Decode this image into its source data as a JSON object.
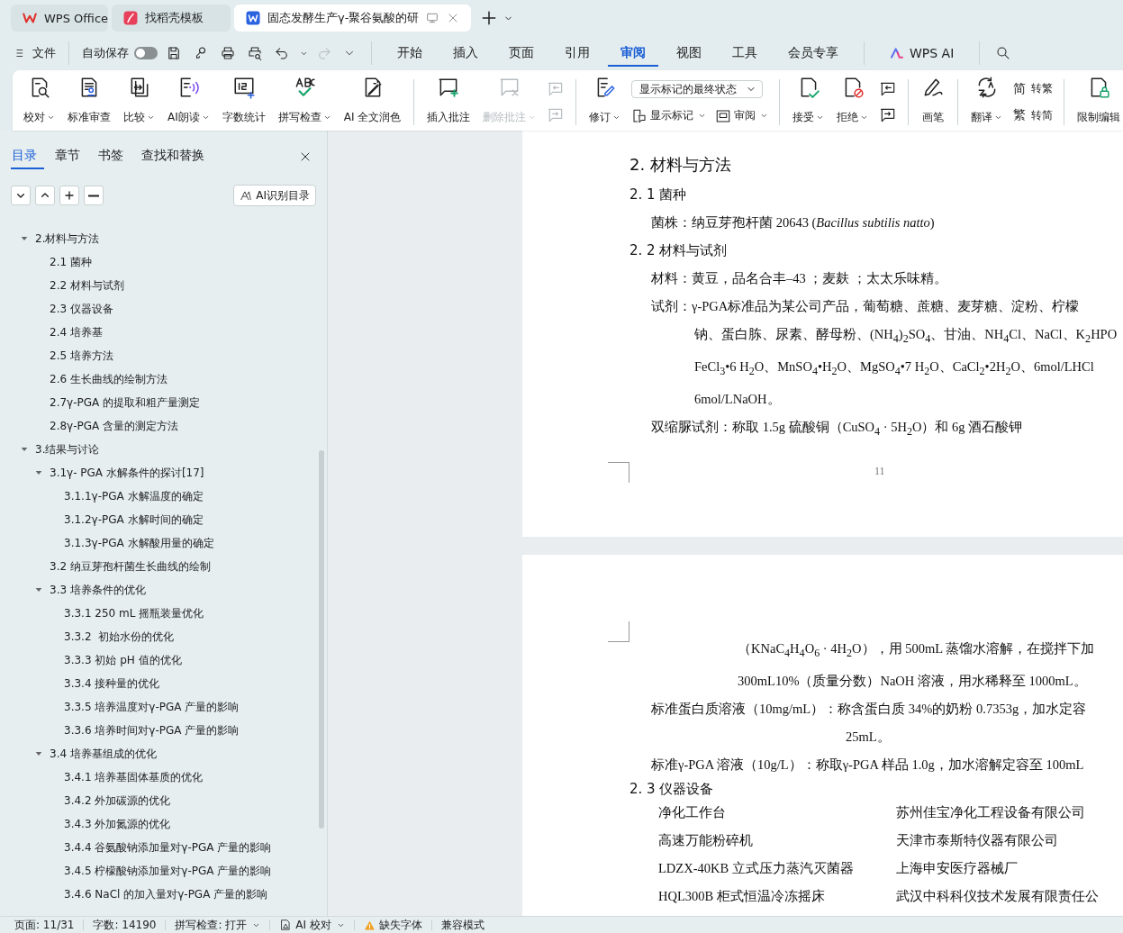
{
  "title_bar": {
    "tabs": [
      {
        "kind": "home",
        "label": "WPS Office",
        "selected": false
      },
      {
        "kind": "template",
        "label": "找稻壳模板",
        "selected": false
      },
      {
        "kind": "document",
        "label": "固态发酵生产γ-聚谷氨酸的研",
        "selected": true
      }
    ]
  },
  "menu_bar": {
    "file_menu": "文件",
    "autosave": {
      "label": "自动保存",
      "on": false
    },
    "redo_disabled": true,
    "tabs": [
      {
        "label": "开始",
        "selected": false
      },
      {
        "label": "插入",
        "selected": false
      },
      {
        "label": "页面",
        "selected": false
      },
      {
        "label": "引用",
        "selected": false
      },
      {
        "label": "审阅",
        "selected": true
      },
      {
        "label": "视图",
        "selected": false
      },
      {
        "label": "工具",
        "selected": false
      },
      {
        "label": "会员专享",
        "selected": false
      }
    ],
    "ai_label": "WPS AI"
  },
  "ribbon": {
    "groups": [
      {
        "items": [
          {
            "kind": "large",
            "label": "校对",
            "dropdown": true,
            "disabled": false
          },
          {
            "kind": "large",
            "label": "标准审查",
            "dropdown": false,
            "disabled": false
          },
          {
            "kind": "large",
            "label": "比较",
            "dropdown": true,
            "disabled": false
          },
          {
            "kind": "large",
            "label": "AI朗读",
            "dropdown": true,
            "disabled": false
          },
          {
            "kind": "large",
            "label": "字数统计",
            "dropdown": false,
            "disabled": false
          },
          {
            "kind": "large",
            "label": "拼写检查",
            "dropdown": true,
            "disabled": false
          },
          {
            "kind": "large",
            "label": "AI 全文润色",
            "dropdown": false,
            "disabled": false
          }
        ]
      },
      {
        "items": [
          {
            "kind": "large",
            "label": "插入批注",
            "dropdown": false,
            "disabled": false
          },
          {
            "kind": "large",
            "label": "删除批注",
            "dropdown": true,
            "disabled": true
          },
          {
            "kind": "stack",
            "rows": [
              [
                {
                  "kind": "icon",
                  "disabled": true
                }
              ],
              [
                {
                  "kind": "icon",
                  "disabled": true
                }
              ]
            ]
          }
        ]
      },
      {
        "items": [
          {
            "kind": "large",
            "label": "修订",
            "dropdown": true,
            "disabled": false
          },
          {
            "kind": "stack",
            "rows": [
              [
                {
                  "kind": "select",
                  "value": "显示标记的最终状态"
                }
              ],
              [
                {
                  "kind": "small",
                  "label": "显示标记",
                  "dropdown": true,
                  "disabled": false
                },
                {
                  "kind": "small",
                  "label": "审阅",
                  "dropdown": true,
                  "disabled": false
                }
              ]
            ]
          }
        ]
      },
      {
        "items": [
          {
            "kind": "large",
            "label": "接受",
            "dropdown": true,
            "disabled": false
          },
          {
            "kind": "large",
            "label": "拒绝",
            "dropdown": true,
            "disabled": false
          },
          {
            "kind": "stack",
            "rows": [
              [
                {
                  "kind": "icon",
                  "disabled": false
                }
              ],
              [
                {
                  "kind": "icon",
                  "disabled": false
                }
              ]
            ]
          }
        ]
      },
      {
        "items": [
          {
            "kind": "large",
            "label": "画笔",
            "dropdown": false,
            "disabled": false
          }
        ]
      },
      {
        "items": [
          {
            "kind": "large",
            "label": "翻译",
            "dropdown": true,
            "disabled": false
          },
          {
            "kind": "stack",
            "rows": [
              [
                {
                  "kind": "convert",
                  "glyph": "简",
                  "label": "转繁"
                }
              ],
              [
                {
                  "kind": "convert",
                  "glyph": "繁",
                  "label": "转简"
                }
              ]
            ]
          }
        ]
      },
      {
        "items": [
          {
            "kind": "large",
            "label": "限制编辑",
            "dropdown": false,
            "disabled": false
          }
        ]
      }
    ]
  },
  "side_panel": {
    "tabs": [
      {
        "label": "目录",
        "selected": true
      },
      {
        "label": "章节",
        "selected": false
      },
      {
        "label": "书签",
        "selected": false
      },
      {
        "label": "查找和替换",
        "selected": false
      }
    ],
    "ai_button": "AI识别目录",
    "toc": [
      {
        "label": "2.材料与方法",
        "expanded": true,
        "children": [
          {
            "label": "2.1 菌种"
          },
          {
            "label": "2.2 材料与试剂"
          },
          {
            "label": "2.3 仪器设备"
          },
          {
            "label": "2.4 培养基"
          },
          {
            "label": "2.5 培养方法"
          },
          {
            "label": "2.6 生长曲线的绘制方法"
          },
          {
            "label": "2.7γ-PGA 的提取和粗产量测定"
          },
          {
            "label": "2.8γ-PGA 含量的测定方法"
          }
        ]
      },
      {
        "label": "3.结果与讨论",
        "expanded": true,
        "children": [
          {
            "label": "3.1γ- PGA 水解条件的探讨[17]",
            "expanded": true,
            "children": [
              {
                "label": "3.1.1γ-PGA 水解温度的确定"
              },
              {
                "label": "3.1.2γ-PGA 水解时间的确定"
              },
              {
                "label": "3.1.3γ-PGA 水解酸用量的确定"
              }
            ]
          },
          {
            "label": "3.2 纳豆芽孢杆菌生长曲线的绘制"
          },
          {
            "label": "3.3 培养条件的优化",
            "expanded": true,
            "children": [
              {
                "label": "3.3.1 250 mL 摇瓶装量优化"
              },
              {
                "label": "3.3.2  初始水份的优化"
              },
              {
                "label": "3.3.3 初始 pH 值的优化"
              },
              {
                "label": "3.3.4 接种量的优化"
              },
              {
                "label": "3.3.5 培养温度对γ-PGA 产量的影响"
              },
              {
                "label": "3.3.6 培养时间对γ-PGA 产量的影响"
              }
            ]
          },
          {
            "label": "3.4 培养基组成的优化",
            "expanded": true,
            "children": [
              {
                "label": "3.4.1 培养基固体基质的优化"
              },
              {
                "label": "3.4.2 外加碳源的优化"
              },
              {
                "label": "3.4.3 外加氮源的优化"
              },
              {
                "label": "3.4.4 谷氨酸钠添加量对γ-PGA 产量的影响"
              },
              {
                "label": "3.4.5 柠檬酸钠添加量对γ-PGA 产量的影响"
              },
              {
                "label": "3.4.6 NaCl 的加入量对γ-PGA 产量的影响"
              }
            ]
          }
        ]
      }
    ]
  },
  "document": {
    "pages": [
      {
        "lines": [
          {
            "kind": "heading",
            "text": "2. 材料与方法"
          },
          {
            "kind": "subheading",
            "text": "2. 1 菌种"
          },
          {
            "kind": "l1",
            "text": "菌株：纳豆芽孢杆菌 20643 (*Bacillus subtilis natto*)"
          },
          {
            "kind": "subheading",
            "text": "2. 2 材料与试剂"
          },
          {
            "kind": "l1",
            "text": "材料：黄豆，品名合丰–43 ；麦麸 ；太太乐味精。"
          },
          {
            "kind": "l1",
            "text": "试剂：γ-PGA标准品为某公司产品，葡萄糖、蔗糖、麦芽糖、淀粉、柠檬"
          },
          {
            "kind": "l2",
            "text": "钠、蛋白胨、尿素、酵母粉、(NH$_{4}$)$_{2}$SO$_{4}$、甘油、NH$_{4}$Cl、NaCl、K$_{2}$HPO"
          },
          {
            "kind": "l2",
            "text": "FeCl$_{3}$•6 H$_{2}$O、MnSO$_{4}$•H$_{2}$O、MgSO$_{4}$•7 H$_{2}$O、CaCl$_{2}$•2H$_{2}$O、6mol/LHCl"
          },
          {
            "kind": "l2",
            "text": "6mol/LNaOH。"
          },
          {
            "kind": "l1",
            "text": "双缩脲试剂：称取 1.5g 硫酸铜（CuSO$_{4}$ · 5H$_{2}$O）和 6g 酒石酸钾"
          }
        ],
        "page_number": "11"
      },
      {
        "lines": [
          {
            "kind": "l3",
            "text": "（KNaC$_{4}$H$_{4}$O$_{6}$ · 4H$_{2}$O），用 500mL 蒸馏水溶解，在搅拌下加"
          },
          {
            "kind": "l3",
            "text": "300mL10%（质量分数）NaOH 溶液，用水稀释至 1000mL。"
          },
          {
            "kind": "l1",
            "text": "标准蛋白质溶液（10mg/mL）：称含蛋白质 34%的奶粉 0.7353g，加水定容"
          },
          {
            "kind": "l4",
            "text": "25mL。"
          },
          {
            "kind": "l1",
            "text": "标准γ-PGA 溶液（10g/L）：称取γ-PGA 样品 1.0g，加水溶解定容至 100mL"
          },
          {
            "kind": "subheading",
            "text": "2. 3 仪器设备"
          },
          {
            "kind": "equipment",
            "name": "净化工作台",
            "maker": "苏州佳宝净化工程设备有限公司"
          },
          {
            "kind": "equipment",
            "name": "高速万能粉碎机",
            "maker": "天津市泰斯特仪器有限公司"
          },
          {
            "kind": "equipment",
            "name": "LDZX-40KB 立式压力蒸汽灭菌器",
            "maker": "上海申安医疗器械厂"
          },
          {
            "kind": "equipment",
            "name": "HQL300B 柜式恒温冷冻摇床",
            "maker": "武汉中科科仪技术发展有限责任公"
          }
        ]
      }
    ]
  },
  "status_bar": {
    "items": [
      {
        "kind": "text",
        "label": "页面: 11/31"
      },
      {
        "kind": "text",
        "label": "字数: 14190"
      },
      {
        "kind": "menu",
        "label": "拼写检查: 打开"
      },
      {
        "kind": "ai",
        "label": "AI 校对"
      },
      {
        "kind": "warning",
        "label": "缺失字体"
      },
      {
        "kind": "text",
        "label": "兼容模式"
      }
    ]
  }
}
